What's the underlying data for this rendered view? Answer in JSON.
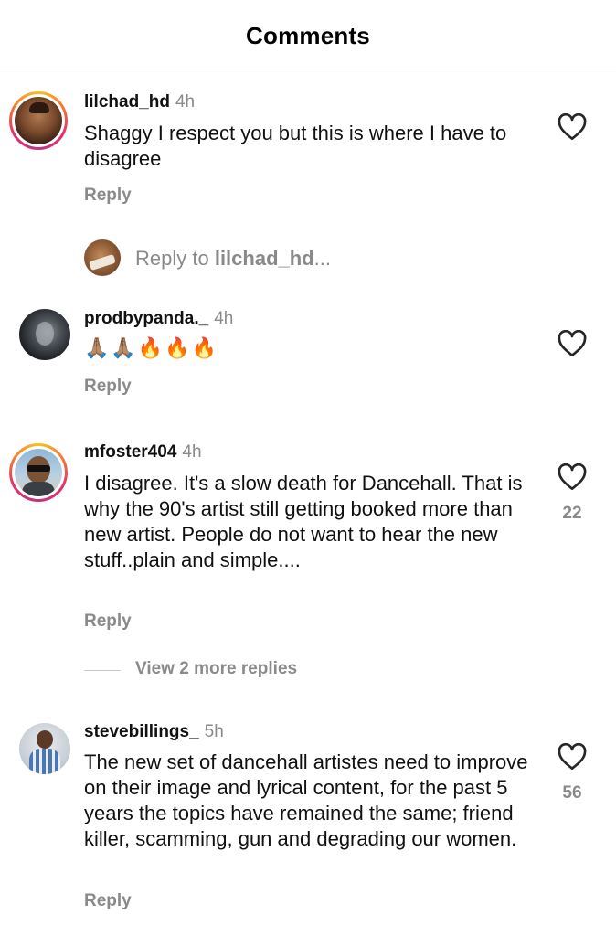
{
  "header": {
    "title": "Comments"
  },
  "comments": [
    {
      "username": "lilchad_hd",
      "time": "4h",
      "text": "Shaggy I respect you but this is where I have to disagree",
      "reply_label": "Reply",
      "likes": ""
    },
    {
      "username": "prodbypanda._",
      "time": "4h",
      "text": "🙏🏽🙏🏽🔥🔥🔥",
      "reply_label": "Reply",
      "likes": ""
    },
    {
      "username": "mfoster404",
      "time": "4h",
      "text": "I disagree. It's a slow death for Dancehall. That is why the 90's artist still getting booked more than new artist. People do not want to hear the new stuff..plain and simple....",
      "reply_label": "Reply",
      "likes": "22"
    },
    {
      "username": "stevebillings_",
      "time": "5h",
      "text": "The new set of dancehall artistes need to improve on their image and lyrical content, for the past 5 years the topics have remained the same; friend killer, scamming, gun and degrading our women.",
      "reply_label": "Reply",
      "likes": "56"
    }
  ],
  "reply_to": {
    "prefix": "Reply to ",
    "username": "lilchad_hd",
    "suffix": "..."
  },
  "view_more": {
    "label": "View 2 more replies"
  },
  "icons": {
    "heart": "heart-outline-icon"
  }
}
